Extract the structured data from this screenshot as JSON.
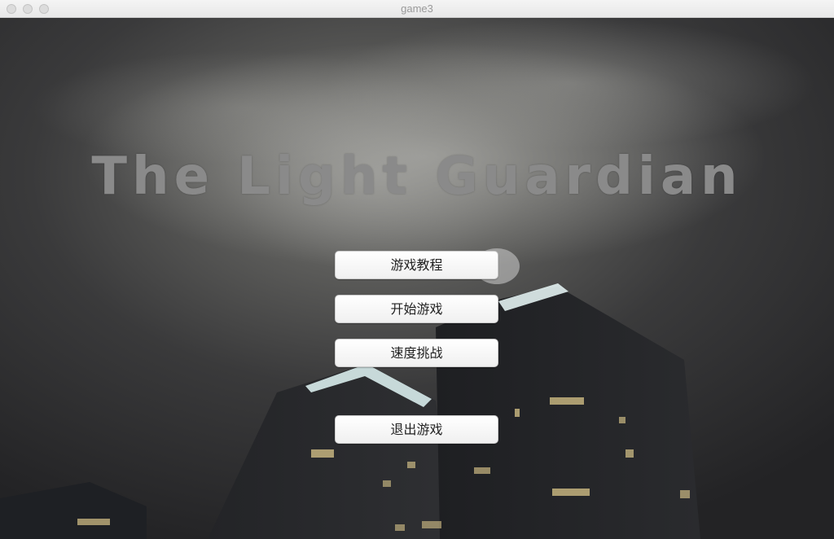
{
  "window": {
    "title": "game3"
  },
  "game": {
    "title": "The Light Guardian"
  },
  "menu": {
    "tutorial_label": "游戏教程",
    "start_label": "开始游戏",
    "speed_challenge_label": "速度挑战",
    "quit_label": "退出游戏"
  }
}
